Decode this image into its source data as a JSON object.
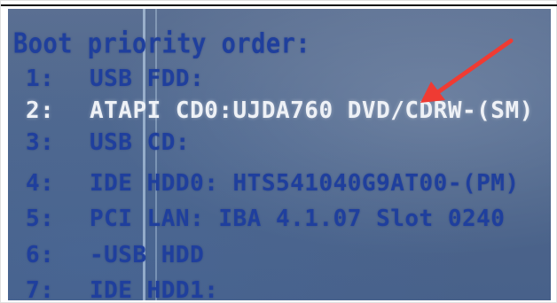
{
  "screen": {
    "title": "Boot priority order:",
    "items": [
      {
        "num": "1:",
        "label": "USB FDD:"
      },
      {
        "num": "2:",
        "label": "ATAPI CD0:UJDA760 DVD/CDRW-(SM)"
      },
      {
        "num": "3:",
        "label": "USB CD:"
      },
      {
        "num": "4:",
        "label": "IDE HDD0: HTS541040G9AT00-(PM)"
      },
      {
        "num": "5:",
        "label": "PCI LAN:  IBA 4.1.07 Slot 0240"
      },
      {
        "num": "6:",
        "label": "-USB HDD"
      },
      {
        "num": "7:",
        "label": "IDE HDD1:"
      }
    ],
    "selected_index": 1
  },
  "colors": {
    "screen_bg": "#50688e",
    "text": "#1f3f9d",
    "highlight_text": "#eef1f6",
    "annotation_arrow": "#ef3b33"
  },
  "annotation": {
    "icon": "arrow-pointing-icon"
  }
}
